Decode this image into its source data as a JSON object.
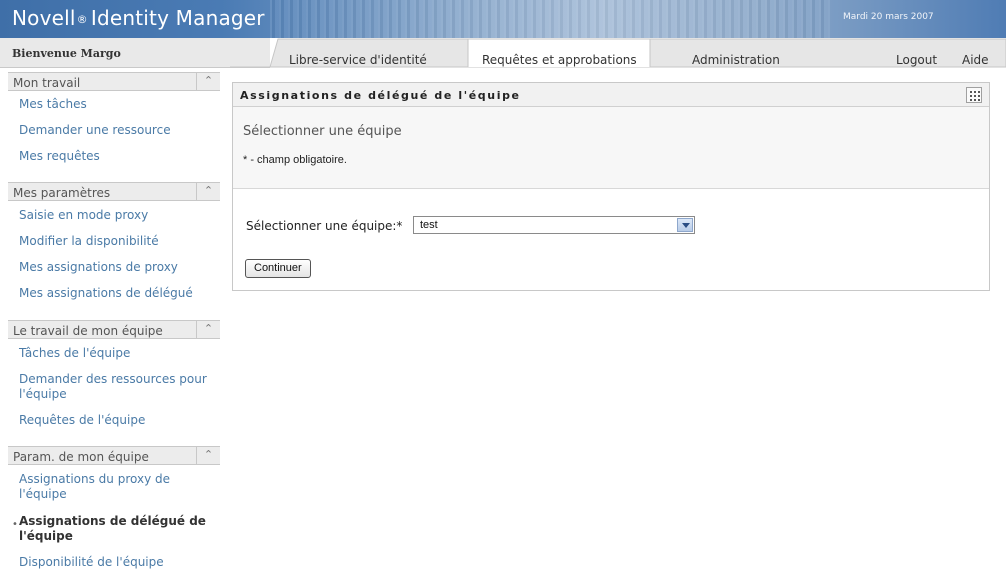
{
  "app": {
    "brand_name": "Novell",
    "brand_registered": "®",
    "product_name": "Identity Manager",
    "date": "Mardi 20 mars 2007",
    "welcome": "Bienvenue Margo"
  },
  "tabs": [
    {
      "label": "Libre-service d'identité",
      "selected": false
    },
    {
      "label": "Requêtes et approbations",
      "selected": true
    },
    {
      "label": "Administration",
      "selected": false
    }
  ],
  "top_links": {
    "logout": "Logout",
    "help": "Aide"
  },
  "sidebar": {
    "sections": [
      {
        "title": "Mon travail",
        "collapse_icon": "double-chevron-up-icon",
        "items": [
          "Mes tâches",
          "Demander une ressource",
          "Mes requêtes"
        ]
      },
      {
        "title": "Mes paramètres",
        "collapse_icon": "double-chevron-up-icon",
        "items": [
          "Saisie en mode proxy",
          "Modifier la disponibilité",
          "Mes assignations de proxy",
          "Mes assignations de délégué"
        ]
      },
      {
        "title": "Le travail de mon équipe",
        "collapse_icon": "double-chevron-up-icon",
        "items": [
          "Tâches de l'équipe",
          "Demander des ressources pour l'équipe",
          "Requêtes de l'équipe"
        ]
      },
      {
        "title": "Param. de mon équipe",
        "collapse_icon": "double-chevron-up-icon",
        "items": [
          "Assignations du proxy de l'équipe",
          "Assignations de délégué de l'équipe",
          "Disponibilité de l'équipe"
        ],
        "active_item": "Assignations de délégué de l'équipe"
      }
    ]
  },
  "panel": {
    "title": "Assignations de délégué de l'équipe",
    "menu_icon": "grid-menu-icon",
    "subtitle": "Sélectionner une équipe",
    "required_note": "* - champ obligatoire.",
    "field_label": "Sélectionner une équipe:*",
    "select_value": "test",
    "continue_label": "Continuer"
  },
  "colors": {
    "banner": "#4a7bb4",
    "link": "#4a7aa6",
    "panel_header": "#f1f1f1"
  }
}
